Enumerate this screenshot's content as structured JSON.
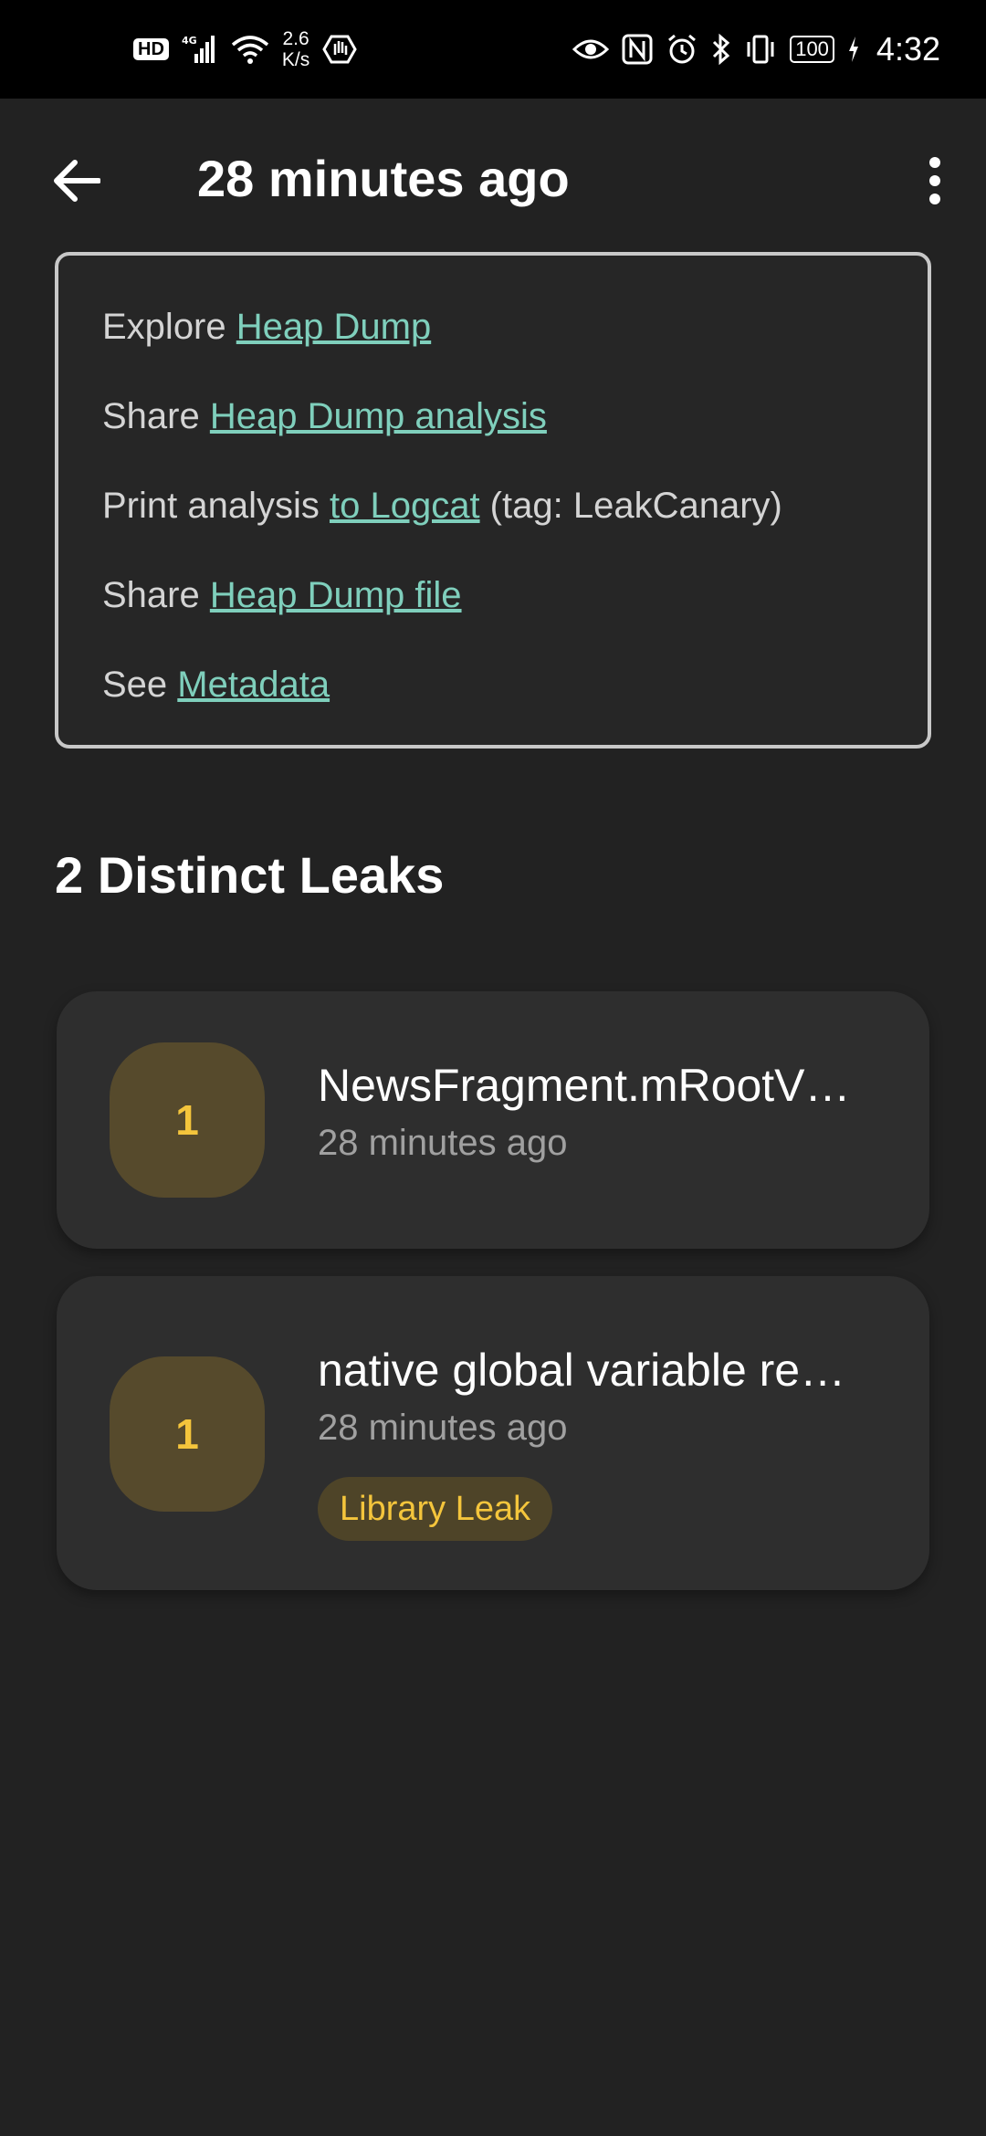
{
  "status_bar": {
    "hd": "HD",
    "network": "4G",
    "speed_value": "2.6",
    "speed_unit": "K/s",
    "battery": "100",
    "time": "4:32"
  },
  "app_bar": {
    "title": "28 minutes ago"
  },
  "actions": [
    {
      "prefix": "Explore ",
      "link": "Heap Dump",
      "suffix": ""
    },
    {
      "prefix": "Share ",
      "link": "Heap Dump analysis",
      "suffix": ""
    },
    {
      "prefix": "Print analysis ",
      "link": "to Logcat",
      "suffix": " (tag: LeakCanary)"
    },
    {
      "prefix": "Share ",
      "link": "Heap Dump file",
      "suffix": ""
    },
    {
      "prefix": "See ",
      "link": "Metadata",
      "suffix": ""
    }
  ],
  "section": {
    "title": "2 Distinct Leaks"
  },
  "leaks": [
    {
      "count": "1",
      "title": "NewsFragment.mRootV…",
      "time": "28 minutes ago",
      "tag": ""
    },
    {
      "count": "1",
      "title": "native global variable re…",
      "time": "28 minutes ago",
      "tag": "Library Leak"
    }
  ],
  "colors": {
    "background": "#222222",
    "link": "#7fcfbc",
    "badge_bg": "#564a2c",
    "badge_text": "#f4c53c"
  }
}
